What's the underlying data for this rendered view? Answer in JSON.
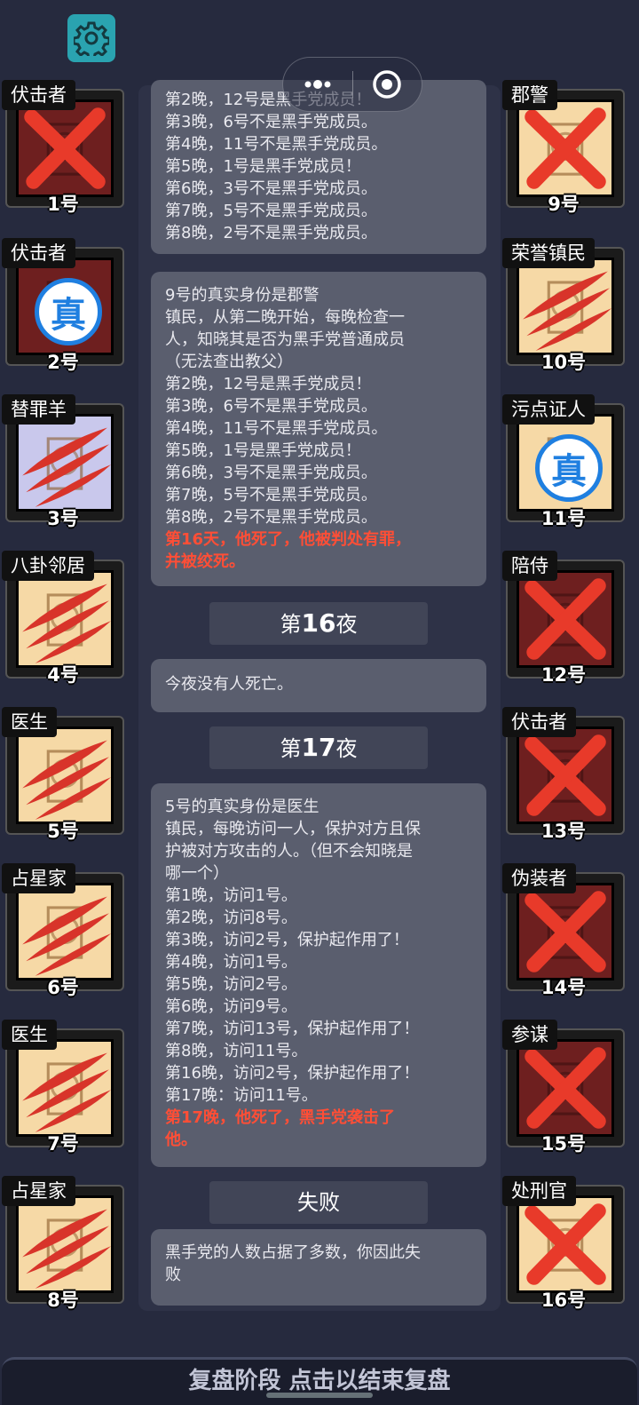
{
  "header": {
    "settings_icon": "gear-icon",
    "capsule_more_icon": "more-dots-icon",
    "capsule_close_icon": "record-circle-icon"
  },
  "players_left": [
    {
      "role": "伏击者",
      "number": "1号",
      "status": "eliminated-x",
      "art": "dark"
    },
    {
      "role": "伏击者",
      "number": "2号",
      "status": "verified-true",
      "art": "dark"
    },
    {
      "role": "替罪羊",
      "number": "3号",
      "status": "slashed",
      "art": "lav"
    },
    {
      "role": "八卦邻居",
      "number": "4号",
      "status": "slashed",
      "art": "light"
    },
    {
      "role": "医生",
      "number": "5号",
      "status": "slashed",
      "art": "light"
    },
    {
      "role": "占星家",
      "number": "6号",
      "status": "slashed",
      "art": "light"
    },
    {
      "role": "医生",
      "number": "7号",
      "status": "slashed",
      "art": "light"
    },
    {
      "role": "占星家",
      "number": "8号",
      "status": "slashed",
      "art": "light"
    }
  ],
  "players_right": [
    {
      "role": "郡警",
      "number": "9号",
      "status": "eliminated-x",
      "art": "light"
    },
    {
      "role": "荣誉镇民",
      "number": "10号",
      "status": "slashed",
      "art": "light"
    },
    {
      "role": "污点证人",
      "number": "11号",
      "status": "verified-true",
      "art": "light"
    },
    {
      "role": "陪侍",
      "number": "12号",
      "status": "eliminated-x",
      "art": "dark"
    },
    {
      "role": "伏击者",
      "number": "13号",
      "status": "eliminated-x",
      "art": "dark"
    },
    {
      "role": "伪装者",
      "number": "14号",
      "status": "eliminated-x",
      "art": "dark"
    },
    {
      "role": "参谋",
      "number": "15号",
      "status": "eliminated-x",
      "art": "dark"
    },
    {
      "role": "处刑官",
      "number": "16号",
      "status": "eliminated-x",
      "art": "light"
    }
  ],
  "verified_badge_text": "真",
  "log": {
    "box1": {
      "lines": [
        "第2晚，12号是黑手党成员！",
        "第3晚，6号不是黑手党成员。",
        "第4晚，11号不是黑手党成员。",
        "第5晚，1号是黑手党成员！",
        "第6晚，3号不是黑手党成员。",
        "第7晚，5号不是黑手党成员。",
        "第8晚，2号不是黑手党成员。"
      ]
    },
    "box2": {
      "lines": [
        "9号的真实身份是郡警",
        "镇民，从第二晚开始，每晚检查一",
        "人，知晓其是否为黑手党普通成员",
        "（无法查出教父）",
        "第2晚，12号是黑手党成员！",
        "第3晚，6号不是黑手党成员。",
        "第4晚，11号不是黑手党成员。",
        "第5晚，1号是黑手党成员！",
        "第6晚，3号不是黑手党成员。",
        "第7晚，5号不是黑手党成员。",
        "第8晚，2号不是黑手党成员。"
      ],
      "red_lines": [
        "第16天，他死了，他被判处有罪，",
        "并被绞死。"
      ]
    },
    "night16": {
      "prefix": "第",
      "number": "16",
      "suffix": "夜"
    },
    "box3": {
      "lines": [
        "今夜没有人死亡。"
      ]
    },
    "night17": {
      "prefix": "第",
      "number": "17",
      "suffix": "夜"
    },
    "box4": {
      "lines": [
        "5号的真实身份是医生",
        "镇民，每晚访问一人，保护对方且保",
        "护被对方攻击的人。（但不会知晓是",
        "哪一个）",
        "第1晚，访问1号。",
        "第2晚，访问8号。",
        "第3晚，访问2号，保护起作用了！",
        "第4晚，访问1号。",
        "第5晚，访问2号。",
        "第6晚，访问9号。",
        "第7晚，访问13号，保护起作用了！",
        "第8晚，访问11号。",
        "第16晚，访问2号，保护起作用了！",
        "第17晚：访问11号。"
      ],
      "red_lines": [
        "第17晚，他死了，黑手党袭击了",
        "他。"
      ]
    },
    "result_header": "失败",
    "box5": {
      "lines": [
        "黑手党的人数占据了多数，你因此失",
        "败"
      ]
    }
  },
  "bottom_bar": {
    "label": "复盘阶段 点击以结束复盘"
  },
  "colors": {
    "background": "#262a3e",
    "log_panel": "#2e3247",
    "entry_box": "#5a5e6e",
    "header_box": "#414557",
    "highlight_red": "#ff4e36",
    "x_mark": "#e83a2a",
    "verified_blue": "#1f7fe0",
    "settings_teal": "#2aa3b0"
  }
}
